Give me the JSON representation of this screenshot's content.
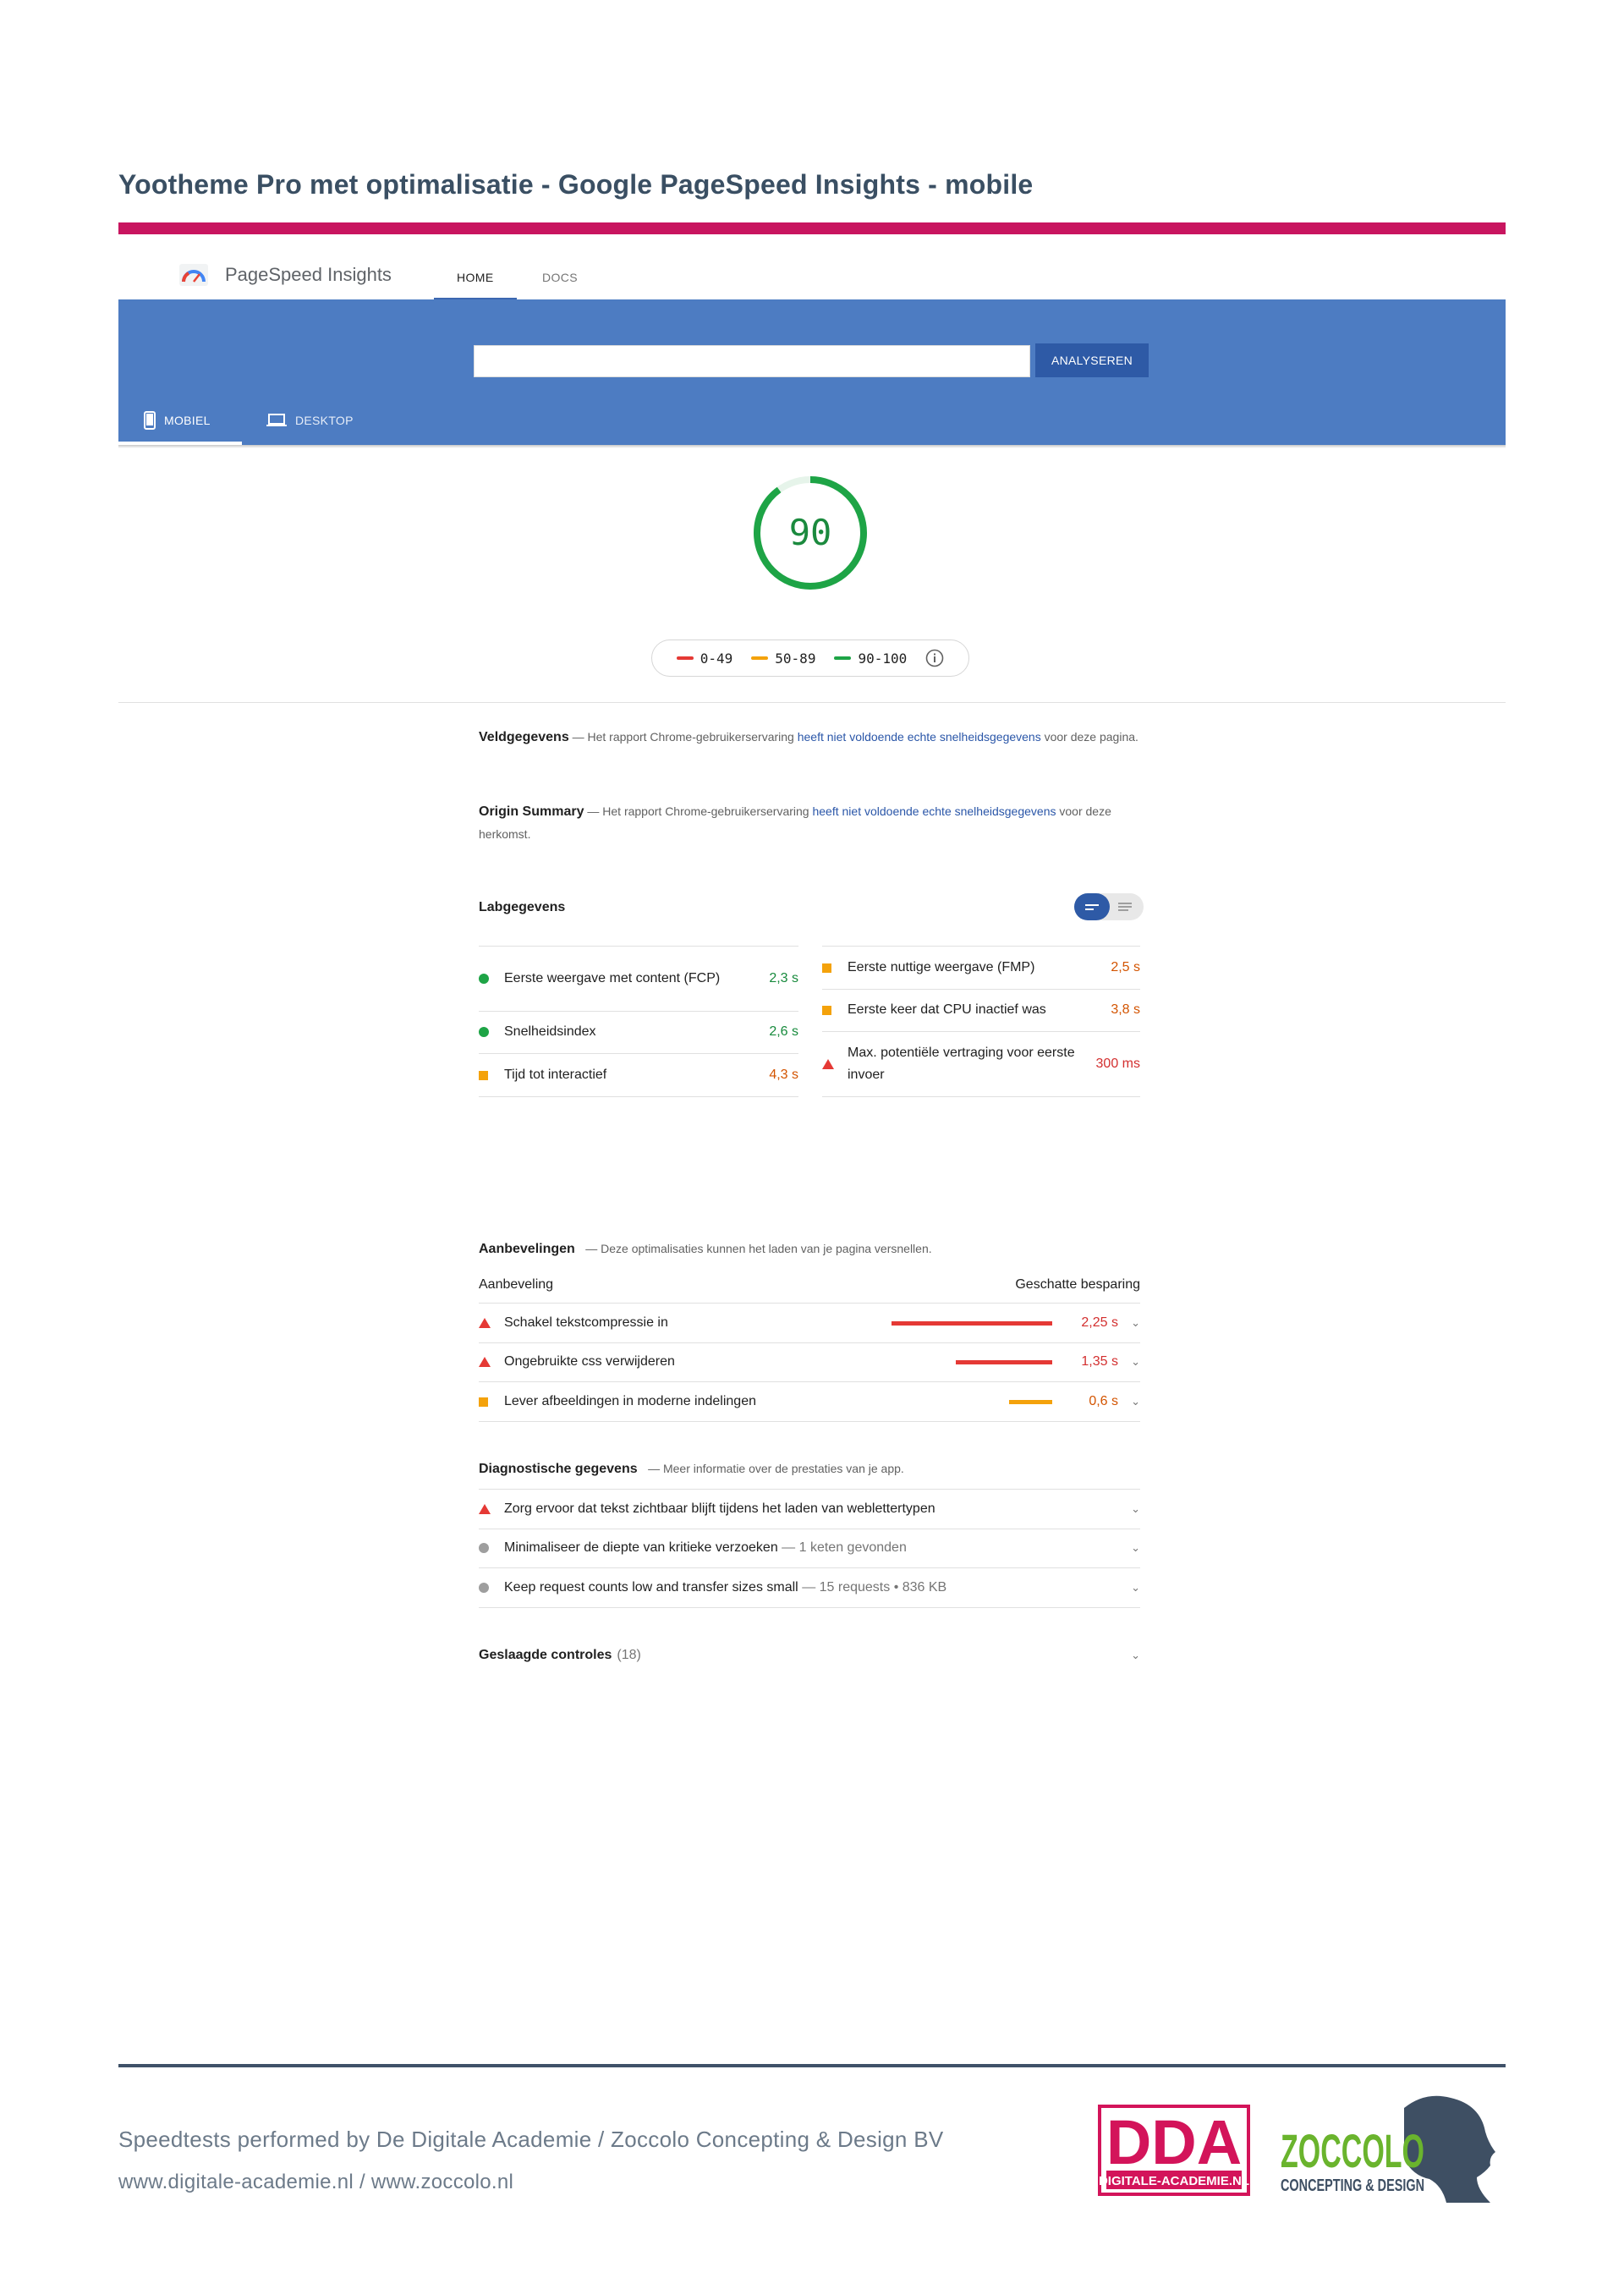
{
  "document": {
    "title": "Yootheme Pro met optimalisatie - Google PageSpeed Insights - mobile",
    "accent_color": "#c8155f"
  },
  "psi": {
    "app_name": "PageSpeed Insights",
    "nav": [
      {
        "label": "HOME",
        "active": true
      },
      {
        "label": "DOCS",
        "active": false
      }
    ],
    "search": {
      "value": "",
      "placeholder": ""
    },
    "analyze_label": "ANALYSEREN",
    "device_tabs": [
      {
        "label": "MOBIEL",
        "icon": "phone-icon",
        "active": true
      },
      {
        "label": "DESKTOP",
        "icon": "laptop-icon",
        "active": false
      }
    ],
    "band_color": "#4d7cc2"
  },
  "score": {
    "value": "90",
    "fraction": 0.9,
    "color": "#1b8a3e"
  },
  "legend": [
    {
      "range": "0-49",
      "color": "#e53935"
    },
    {
      "range": "50-89",
      "color": "#f4a20b"
    },
    {
      "range": "90-100",
      "color": "#1ea446"
    }
  ],
  "field_data": {
    "title": "Veldgegevens",
    "desc_prefix": "— Het rapport Chrome-gebruikerservaring ",
    "desc_link": "heeft niet voldoende echte snelheidsgegevens",
    "desc_suffix": " voor deze pagina."
  },
  "origin_summary": {
    "title": "Origin Summary",
    "desc_prefix": "— Het rapport Chrome-gebruikerservaring ",
    "desc_link": "heeft niet voldoende echte snelheidsgegevens",
    "desc_suffix": " voor deze herkomst."
  },
  "lab": {
    "title": "Labgegevens",
    "left": [
      {
        "label": "Eerste weergave met content (FCP)",
        "value": "2,3 s",
        "status": "green"
      },
      {
        "label": "Snelheidsindex",
        "value": "2,6 s",
        "status": "green"
      },
      {
        "label": "Tijd tot interactief",
        "value": "4,3 s",
        "status": "orange"
      }
    ],
    "right": [
      {
        "label": "Eerste nuttige weergave (FMP)",
        "value": "2,5 s",
        "status": "orange"
      },
      {
        "label": "Eerste keer dat CPU inactief was",
        "value": "3,8 s",
        "status": "orange"
      },
      {
        "label": "Max. potentiële vertraging voor eerste invoer",
        "value": "300 ms",
        "status": "red"
      }
    ]
  },
  "opportunities": {
    "title": "Aanbevelingen",
    "desc": "— Deze optimalisaties kunnen het laden van je pagina versnellen.",
    "col_left": "Aanbeveling",
    "col_right": "Geschatte besparing",
    "items": [
      {
        "label": "Schakel tekstcompressie in",
        "value": "2,25 s",
        "seconds": 2.25,
        "status": "red"
      },
      {
        "label": "Ongebruikte css verwijderen",
        "value": "1,35 s",
        "seconds": 1.35,
        "status": "red"
      },
      {
        "label": "Lever afbeeldingen in moderne indelingen",
        "value": "0,6 s",
        "seconds": 0.6,
        "status": "orange"
      }
    ]
  },
  "diagnostics": {
    "title": "Diagnostische gegevens",
    "desc": "— Meer informatie over de prestaties van je app.",
    "items": [
      {
        "label": "Zorg ervoor dat tekst zichtbaar blijft tijdens het laden van weblettertypen",
        "detail": "",
        "status": "red"
      },
      {
        "label": "Minimaliseer de diepte van kritieke verzoeken",
        "detail": "— 1 keten gevonden",
        "status": "grey"
      },
      {
        "label": "Keep request counts low and transfer sizes small",
        "detail": "— 15 requests • 836 KB",
        "status": "grey"
      }
    ]
  },
  "passed": {
    "title": "Geslaagde controles",
    "count": "(18)"
  },
  "footer": {
    "line1": "Speedtests performed by De Digitale Academie / Zoccolo Concepting & Design BV",
    "line2": "www.digitale-academie.nl / www.zoccolo.nl",
    "dda_logo": {
      "big": "DDA",
      "small": "DIGITALE-ACADEMIE.NL",
      "color": "#d3145a"
    },
    "zoccolo_logo": {
      "big": "ZOCCOLO",
      "small": "CONCEPTING & DESIGN",
      "green": "#6ab42d",
      "dark": "#3e4f63"
    }
  }
}
